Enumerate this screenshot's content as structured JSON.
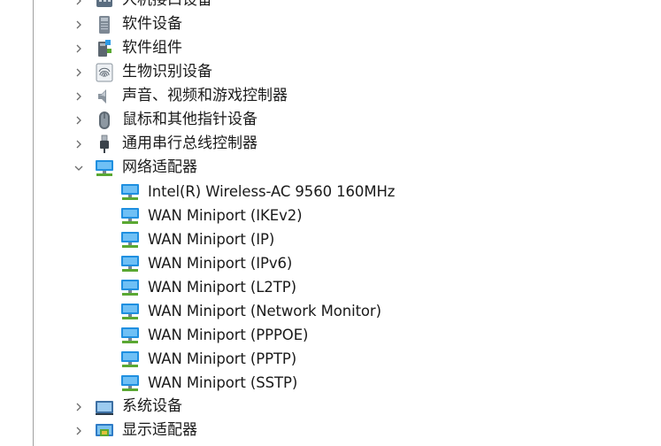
{
  "categories_top": [
    {
      "label": "人机接口设备",
      "icon": "hid-icon",
      "expanded": false
    },
    {
      "label": "软件设备",
      "icon": "software-device-icon",
      "expanded": false
    },
    {
      "label": "软件组件",
      "icon": "software-component-icon",
      "expanded": false
    },
    {
      "label": "生物识别设备",
      "icon": "fingerprint-icon",
      "expanded": false
    },
    {
      "label": "声音、视频和游戏控制器",
      "icon": "speaker-icon",
      "expanded": false
    },
    {
      "label": "鼠标和其他指针设备",
      "icon": "mouse-icon",
      "expanded": false
    },
    {
      "label": "通用串行总线控制器",
      "icon": "usb-icon",
      "expanded": false
    }
  ],
  "network": {
    "label": "网络适配器",
    "icon": "network-adapter-icon",
    "expanded": true,
    "children": [
      "Intel(R) Wireless-AC 9560 160MHz",
      "WAN Miniport (IKEv2)",
      "WAN Miniport (IP)",
      "WAN Miniport (IPv6)",
      "WAN Miniport (L2TP)",
      "WAN Miniport (Network Monitor)",
      "WAN Miniport (PPPOE)",
      "WAN Miniport (PPTP)",
      "WAN Miniport (SSTP)"
    ]
  },
  "categories_bottom": [
    {
      "label": "系统设备",
      "icon": "system-device-icon",
      "expanded": false
    },
    {
      "label": "显示适配器",
      "icon": "display-adapter-icon",
      "expanded": false
    }
  ],
  "colors": {
    "chevron": "#6b6b6b",
    "network_blue": "#1f8fe0",
    "network_green": "#5aa832"
  }
}
